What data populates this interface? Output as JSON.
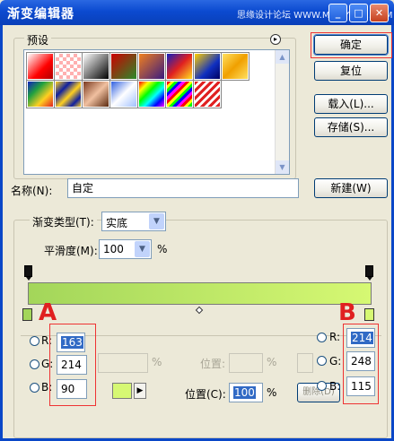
{
  "window": {
    "title": "渐变编辑器",
    "watermark": "思缘设计论坛 WWW.MISSYUAN.COM",
    "min_glyph": "_",
    "max_glyph": "□",
    "close_glyph": "✕"
  },
  "presets": {
    "label": "预设",
    "menu_glyph": "▸",
    "scroll_up_glyph": "▲",
    "scroll_down_glyph": "▼"
  },
  "buttons": {
    "ok": "确定",
    "reset": "复位",
    "load": "载入(L)...",
    "save": "存储(S)...",
    "new": "新建(W)"
  },
  "name": {
    "label": "名称(N):",
    "value": "自定"
  },
  "gradient_type": {
    "label": "渐变类型(T):",
    "value": "实底",
    "arrow_glyph": "▼"
  },
  "smoothness": {
    "label": "平滑度(M):",
    "value": "100",
    "unit": "%",
    "arrow_glyph": "▼"
  },
  "gradient": {
    "left_color": "#a3d65a",
    "right_color": "#d6f873"
  },
  "stops": {
    "opacity_pct_unit": "%",
    "location_label_gray": "位置:",
    "location_label": "位置(C):",
    "location_value": "100",
    "location_unit": "%",
    "delete_label": "删除(D)",
    "play_glyph": "▶",
    "swatch_color": "#d6f873"
  },
  "left_color": {
    "r_label": "R:",
    "g_label": "G:",
    "b_label": "B:",
    "r": "163",
    "g": "214",
    "b": "90"
  },
  "right_color": {
    "r_label": "R:",
    "g_label": "G:",
    "b_label": "B:",
    "r": "214",
    "g": "248",
    "b": "115"
  },
  "annotations": {
    "left_letter": "A",
    "right_letter": "B"
  }
}
